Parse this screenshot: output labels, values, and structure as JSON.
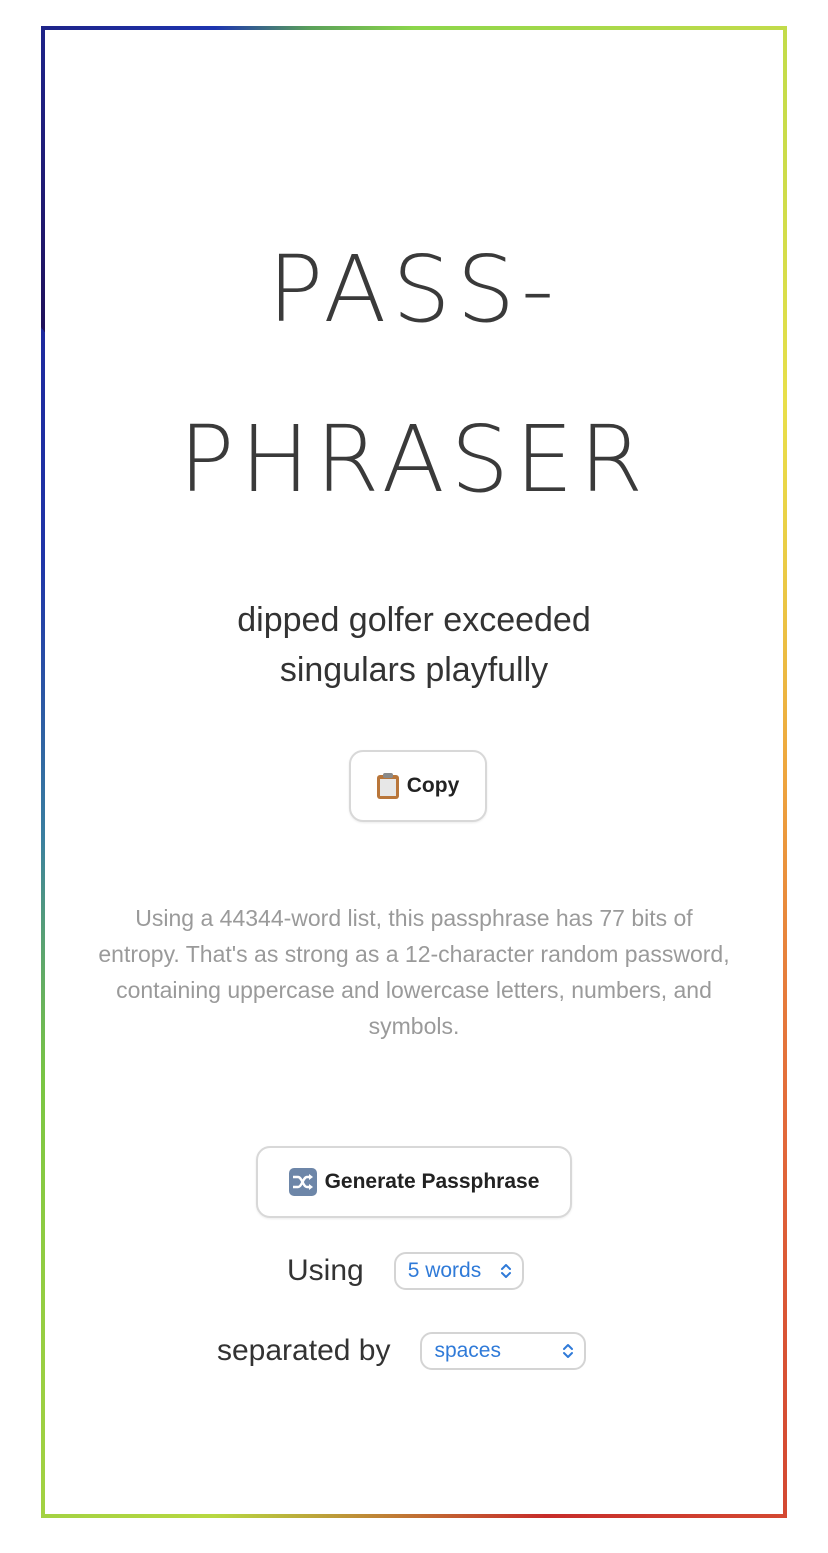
{
  "title": {
    "line1": "PASS-",
    "line2": "PHRASER"
  },
  "passphrase": "dipped golfer exceeded singulars playfully",
  "copy_button": {
    "icon": "clipboard-icon",
    "label": "Copy"
  },
  "info_text": "Using a 44344-word list, this passphrase has 77 bits of entropy. That's as strong as a 12-character random password, containing uppercase and lowercase letters, numbers, and symbols.",
  "generate_button": {
    "icon": "shuffle-icon",
    "label": "Generate Passphrase"
  },
  "options": {
    "words_label": "Using",
    "words_value": "5 words",
    "separator_label": "separated by",
    "separator_value": "spaces"
  },
  "colors": {
    "accent_link": "#2f7ad8",
    "text": "#333333",
    "muted_text": "#9a9a9a"
  }
}
